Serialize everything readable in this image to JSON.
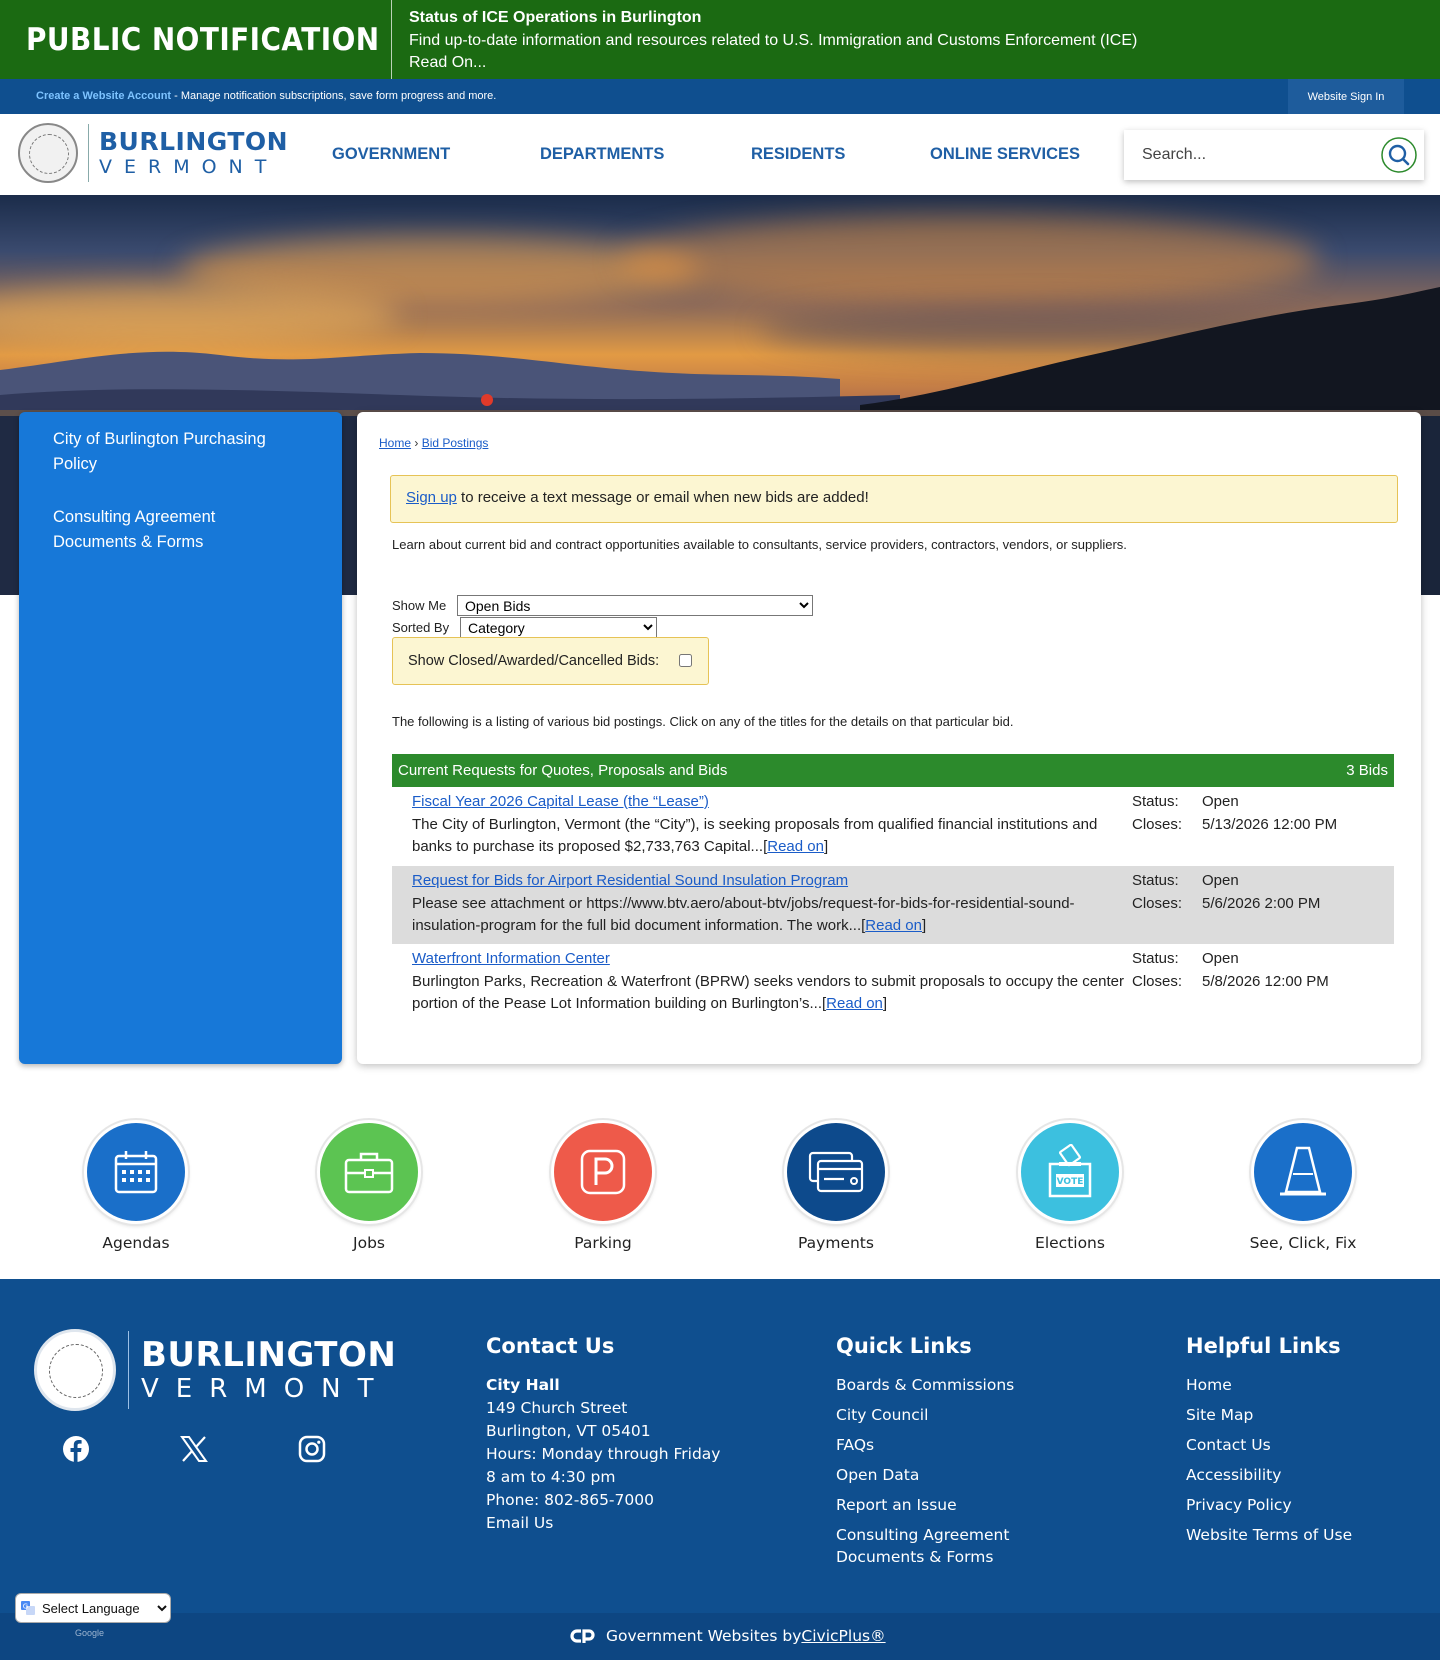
{
  "alert": {
    "brand": "PUBLIC NOTIFICATION",
    "heading": "Status of ICE Operations in Burlington",
    "body": "Find up-to-date information and resources related to U.S. Immigration and Customs Enforcement (ICE)",
    "read_on": "Read On..."
  },
  "account": {
    "create_link": "Create a Website Account",
    "create_text": " - Manage notification subscriptions, save form progress and more.",
    "sign_in": "Website Sign In"
  },
  "logo": {
    "line1": "BURLINGTON",
    "line2": "VERMONT"
  },
  "nav": [
    "GOVERNMENT",
    "DEPARTMENTS",
    "RESIDENTS",
    "ONLINE SERVICES"
  ],
  "search": {
    "placeholder": "Search..."
  },
  "sidebar": {
    "items": [
      {
        "label": "City of Burlington Purchasing Policy"
      },
      {
        "label": "Consulting Agreement Documents & Forms"
      }
    ]
  },
  "breadcrumb": {
    "home": "Home",
    "separator": "›",
    "current": "Bid Postings"
  },
  "signup": {
    "link": "Sign up",
    "text": " to receive a text message or email when new bids are added!"
  },
  "intro": "Learn about current bid and contract opportunities available to consultants, service providers, contractors, vendors, or suppliers.",
  "filters": {
    "show_me_label": "Show Me",
    "show_me_value": "Open Bids",
    "sorted_by_label": "Sorted By",
    "sorted_by_value": "Category",
    "closed_label": "Show Closed/Awarded/Cancelled Bids:"
  },
  "listing_note": "The following is a listing of various bid postings. Click on any of the titles for the details on that particular bid.",
  "bids_header": {
    "title": "Current Requests for Quotes, Proposals and Bids",
    "count": "3 Bids"
  },
  "bids": [
    {
      "title": "Fiscal Year 2026 Capital Lease (the “Lease”)",
      "description": "The City of Burlington, Vermont (the “City”), is seeking proposals from qualified financial institutions and banks to purchase its proposed $2,733,763 Capital...",
      "read_on": "Read on",
      "status_label": "Status:",
      "status": "Open",
      "closes_label": "Closes:",
      "closes": "5/13/2026 12:00 PM"
    },
    {
      "title": "Request for Bids for Airport Residential Sound Insulation Program",
      "description": "Please see attachment or https://www.btv.aero/about-btv/jobs/request-for-bids-for-residential-sound-insulation-program for the full bid document information. The work...",
      "read_on": "Read on",
      "status_label": "Status:",
      "status": "Open",
      "closes_label": "Closes:",
      "closes": "5/6/2026 2:00 PM"
    },
    {
      "title": "Waterfront Information Center",
      "description": "Burlington Parks, Recreation & Waterfront (BPRW) seeks vendors to submit proposals to occupy the center portion of the Pease Lot Information building on Burlington’s...",
      "read_on": "Read on",
      "status_label": "Status:",
      "status": "Open",
      "closes_label": "Closes:",
      "closes": "5/8/2026 12:00 PM"
    }
  ],
  "quick_links": [
    {
      "label": "Agendas",
      "icon": "calendar-icon",
      "color": "#1a6fc9"
    },
    {
      "label": "Jobs",
      "icon": "briefcase-icon",
      "color": "#5cc452"
    },
    {
      "label": "Parking",
      "icon": "parking-icon",
      "color": "#ee5a4a"
    },
    {
      "label": "Payments",
      "icon": "payment-card-icon",
      "color": "#0d4a8c"
    },
    {
      "label": "Elections",
      "icon": "ballot-box-icon",
      "color": "#3cc0df"
    },
    {
      "label": "See, Click, Fix",
      "icon": "traffic-cone-icon",
      "color": "#1a6fc9"
    }
  ],
  "footer": {
    "logo": {
      "line1": "BURLINGTON",
      "line2": "VERMONT"
    },
    "contact": {
      "heading": "Contact Us",
      "name": "City Hall",
      "lines": [
        "149 Church Street",
        "Burlington, VT 05401",
        "Hours: Monday through Friday",
        "8 am to 4:30 pm",
        "Phone: 802-865-7000"
      ],
      "email": "Email Us"
    },
    "quick": {
      "heading": "Quick Links",
      "links": [
        "Boards & Commissions",
        "City Council",
        "FAQs",
        "Open Data",
        "Report an Issue",
        "Consulting Agreement Documents & Forms"
      ]
    },
    "helpful": {
      "heading": "Helpful Links",
      "links": [
        "Home",
        "Site Map",
        "Contact Us",
        "Accessibility",
        "Privacy Policy",
        "Website Terms of Use"
      ]
    }
  },
  "bottom": {
    "powered_text": "Government Websites by ",
    "powered_link": "CivicPlus®"
  },
  "language": {
    "selected": "Select Language",
    "note": "Google"
  },
  "colors": {
    "alert_green": "#1b6a12",
    "brand_blue": "#0f4f8f",
    "link_blue": "#1a5cc8",
    "list_green": "#2c8a2c",
    "sidebar_blue": "#1778d8"
  }
}
